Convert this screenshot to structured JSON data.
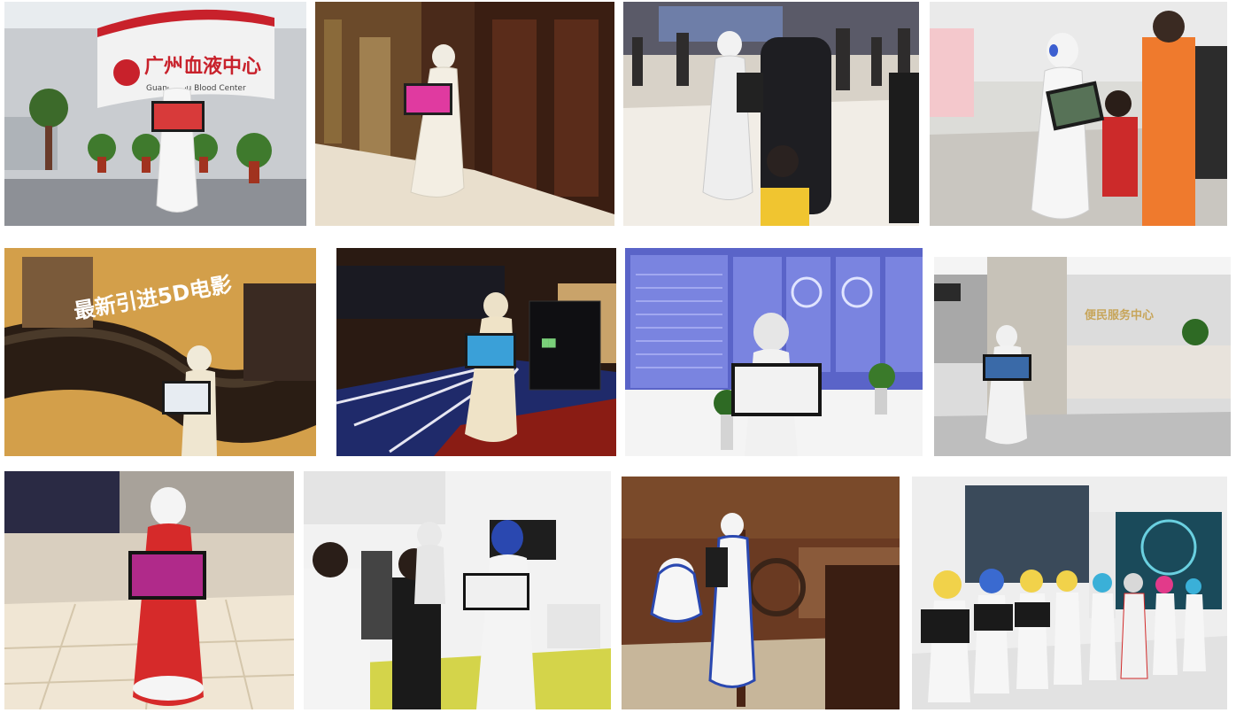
{
  "gallery": {
    "photos": [
      {
        "scene": "blood-center-lobby",
        "sign_cn": "广州血液中心",
        "sign_en": "Guangzhou Blood Center"
      },
      {
        "scene": "hotel-corridor"
      },
      {
        "scene": "mall-crowd"
      },
      {
        "scene": "mall-family"
      },
      {
        "scene": "cinema-5d-wall",
        "sign_cn": "最新引进5D电影"
      },
      {
        "scene": "dark-hall"
      },
      {
        "scene": "control-room-screens"
      },
      {
        "scene": "service-hall",
        "sign_cn": "便民服务中心"
      },
      {
        "scene": "mall-atrium-red-robot"
      },
      {
        "scene": "expo-booth"
      },
      {
        "scene": "restaurant"
      },
      {
        "scene": "robot-lineup"
      }
    ]
  }
}
